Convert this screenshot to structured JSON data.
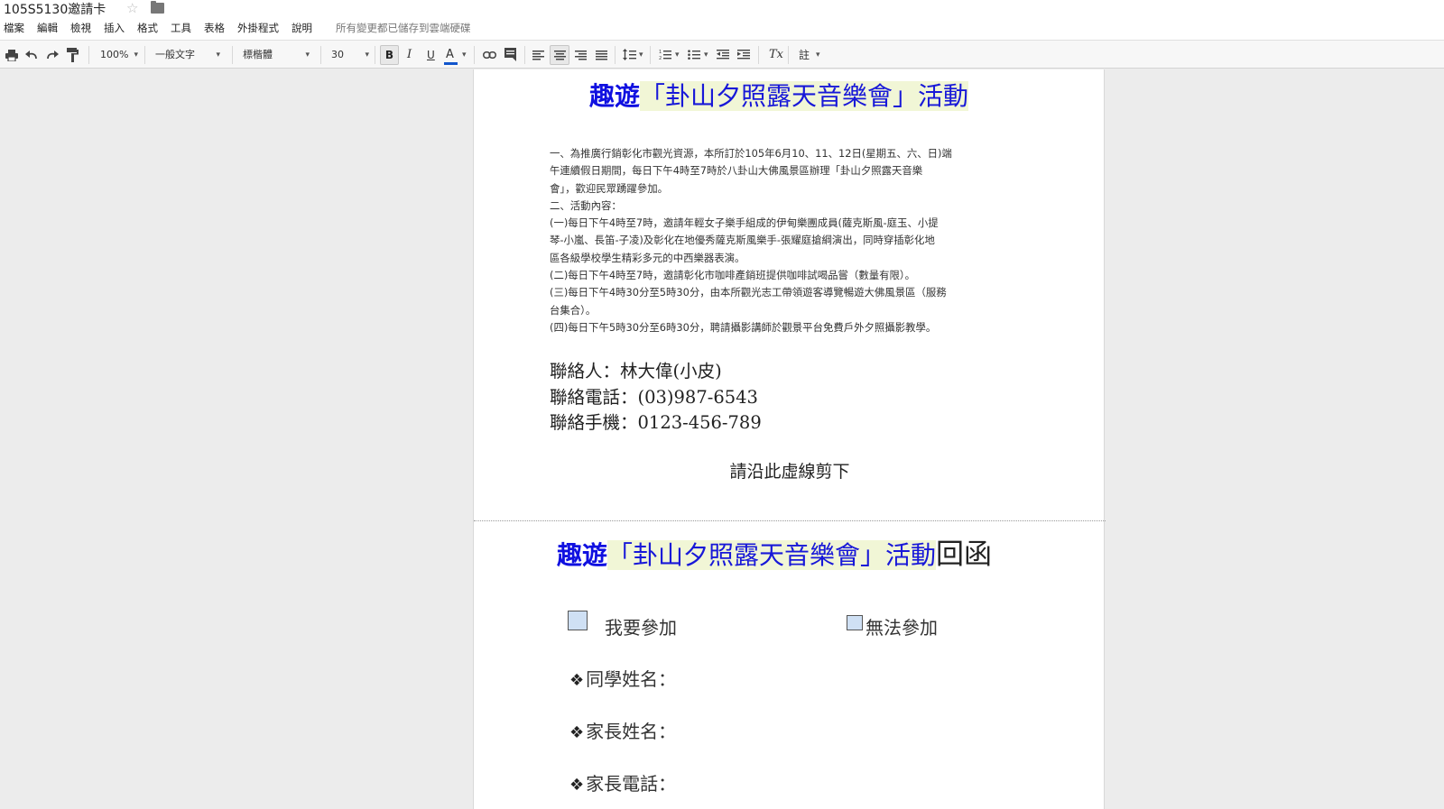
{
  "header": {
    "doc_title": "105S5130邀請卡",
    "save_status": "所有變更都已儲存到雲端硬碟",
    "menu": [
      "檔案",
      "編輯",
      "檢視",
      "插入",
      "格式",
      "工具",
      "表格",
      "外掛程式",
      "說明"
    ]
  },
  "toolbar": {
    "zoom": "100%",
    "style": "一般文字",
    "font": "標楷體",
    "font_size": "30",
    "bold_label": "B",
    "italic_label": "I",
    "underline_label": "U",
    "text_color_label": "A",
    "clear_format_label": "Tx",
    "comment_label": "註",
    "text_color_hex": "#1155cc"
  },
  "document": {
    "title1": {
      "part1": "趣遊",
      "part2": "「卦山夕照露天音樂會」活動"
    },
    "body_lines": [
      "一、為推廣行銷彰化市觀光資源，本所訂於105年6月10、11、12日(星期五、六、日)端",
      "午連續假日期間，每日下午4時至7時於八卦山大佛風景區辦理「卦山夕照露天音樂",
      "會」，歡迎民眾踴躍參加。",
      "二、活動內容：",
      "(一)每日下午4時至7時，邀請年輕女子樂手組成的伊甸樂團成員(薩克斯風-庭玉、小提",
      "琴-小嵐、長笛-子凌)及彰化在地優秀薩克斯風樂手-張耀庭搶綱演出，同時穿插彰化地",
      "區各級學校學生精彩多元的中西樂器表演。",
      "(二)每日下午4時至7時，邀請彰化市咖啡產銷班提供咖啡試喝品嘗（數量有限）。",
      "(三)每日下午4時30分至5時30分，由本所觀光志工帶領遊客導覽暢遊大佛風景區（服務",
      "台集合）。",
      "(四)每日下午5時30分至6時30分，聘請攝影講師於觀景平台免費戶外夕照攝影教學。"
    ],
    "contact": [
      "聯絡人：林大偉(小皮)",
      "聯絡電話：(03)987-6543",
      "聯絡手機：0123-456-789"
    ],
    "cut_note": "請沿此虛線剪下",
    "title2": {
      "part1": "趣遊",
      "part2": "「卦山夕照露天音樂會」活動",
      "part3": "回函"
    },
    "option_attend": "我要參加",
    "option_decline": "無法參加",
    "fields": [
      "同學姓名：",
      "家長姓名：",
      "家長電話："
    ],
    "bullet": "❖"
  }
}
